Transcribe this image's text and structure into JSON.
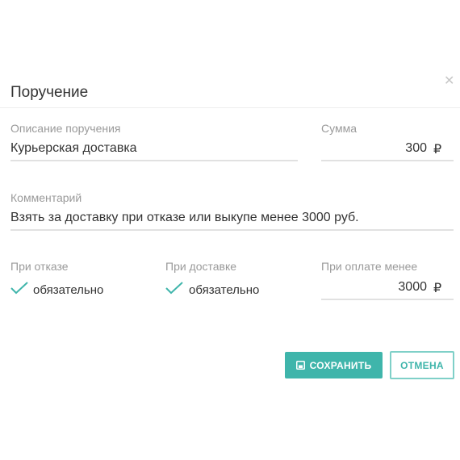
{
  "dialog": {
    "title": "Поручение",
    "close_icon": "close-icon"
  },
  "fields": {
    "description_label": "Описание поручения",
    "description_value": "Курьерская доставка",
    "sum_label": "Сумма",
    "sum_value": "300",
    "currency": "₽",
    "comment_label": "Комментарий",
    "comment_value": "Взять за доставку при отказе или выкупе менее 3000 руб.",
    "refusal_label": "При отказе",
    "refusal_check": "обязательно",
    "delivery_label": "При доставке",
    "delivery_check": "обязательно",
    "payment_label": "При оплате менее",
    "payment_value": "3000",
    "payment_currency": "₽"
  },
  "buttons": {
    "save": "СОХРАНИТЬ",
    "cancel": "ОТМЕНА"
  },
  "colors": {
    "accent": "#3fb5ab",
    "check": "#3fb5ab"
  }
}
